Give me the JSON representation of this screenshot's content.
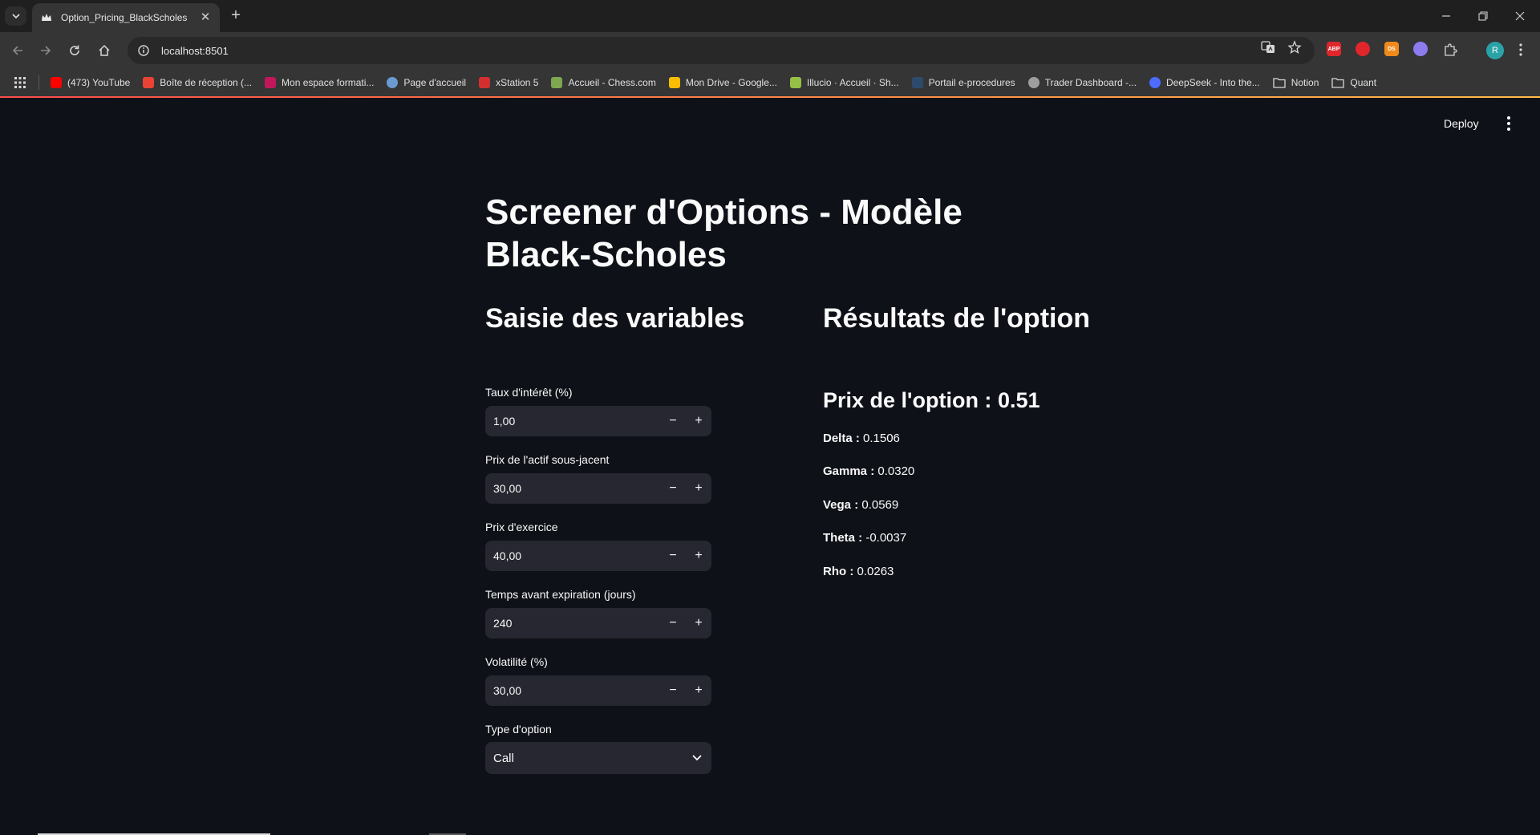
{
  "browser": {
    "tab": {
      "title": "Option_Pricing_BlackScholes"
    },
    "address": {
      "url": "localhost:8501"
    },
    "profile_initial": "R",
    "extensions": [
      {
        "label": "ABP",
        "color": "#e0262b"
      },
      {
        "label": "",
        "color": "#e0262b"
      },
      {
        "label": "DS",
        "color": "#f08a1c"
      },
      {
        "label": "",
        "color": "#8c7cf0"
      }
    ],
    "bookmarks": [
      {
        "label": "(473) YouTube",
        "icon": "youtube-icon",
        "color": "#ff0000"
      },
      {
        "label": "Boîte de réception (...",
        "icon": "gmail-icon",
        "color": "#ea4335"
      },
      {
        "label": "Mon espace formati...",
        "icon": "un-icon",
        "color": "#c2185b"
      },
      {
        "label": "Page d'accueil",
        "icon": "globe-icon",
        "color": "#6b9bd1"
      },
      {
        "label": "xStation 5",
        "icon": "xstation-icon",
        "color": "#d32f2f"
      },
      {
        "label": "Accueil - Chess.com",
        "icon": "chess-icon",
        "color": "#7fa650"
      },
      {
        "label": "Mon Drive - Google...",
        "icon": "drive-icon",
        "color": "#fbbc04"
      },
      {
        "label": "Illucio · Accueil · Sh...",
        "icon": "shopify-icon",
        "color": "#95bf47"
      },
      {
        "label": "Portail e-procedures",
        "icon": "portal-icon",
        "color": "#2e4a6b"
      },
      {
        "label": "Trader Dashboard -...",
        "icon": "globe-icon",
        "color": "#9e9e9e"
      },
      {
        "label": "DeepSeek - Into the...",
        "icon": "deepseek-icon",
        "color": "#4d6bfe"
      },
      {
        "label": "Notion",
        "icon": "folder-icon",
        "color": ""
      },
      {
        "label": "Quant",
        "icon": "folder-icon",
        "color": ""
      }
    ]
  },
  "app": {
    "deploy_label": "Deploy",
    "title": "Screener d'Options - Modèle Black-Scholes",
    "inputs_header": "Saisie des variables",
    "results_header": "Résultats de l'option",
    "inputs": [
      {
        "label": "Taux d'intérêt (%)",
        "value": "1,00"
      },
      {
        "label": "Prix de l'actif sous-jacent",
        "value": "30,00"
      },
      {
        "label": "Prix d'exercice",
        "value": "40,00"
      },
      {
        "label": "Temps avant expiration (jours)",
        "value": "240"
      },
      {
        "label": "Volatilité (%)",
        "value": "30,00"
      }
    ],
    "option_type": {
      "label": "Type d'option",
      "value": "Call"
    },
    "results": {
      "price_label": "Prix de l'option : ",
      "price_value": "0.51",
      "greeks": [
        {
          "name": "Delta :",
          "value": " 0.1506"
        },
        {
          "name": "Gamma :",
          "value": " 0.0320"
        },
        {
          "name": "Vega :",
          "value": " 0.0569"
        },
        {
          "name": "Theta :",
          "value": " -0.0037"
        },
        {
          "name": "Rho :",
          "value": " 0.0263"
        }
      ]
    }
  }
}
